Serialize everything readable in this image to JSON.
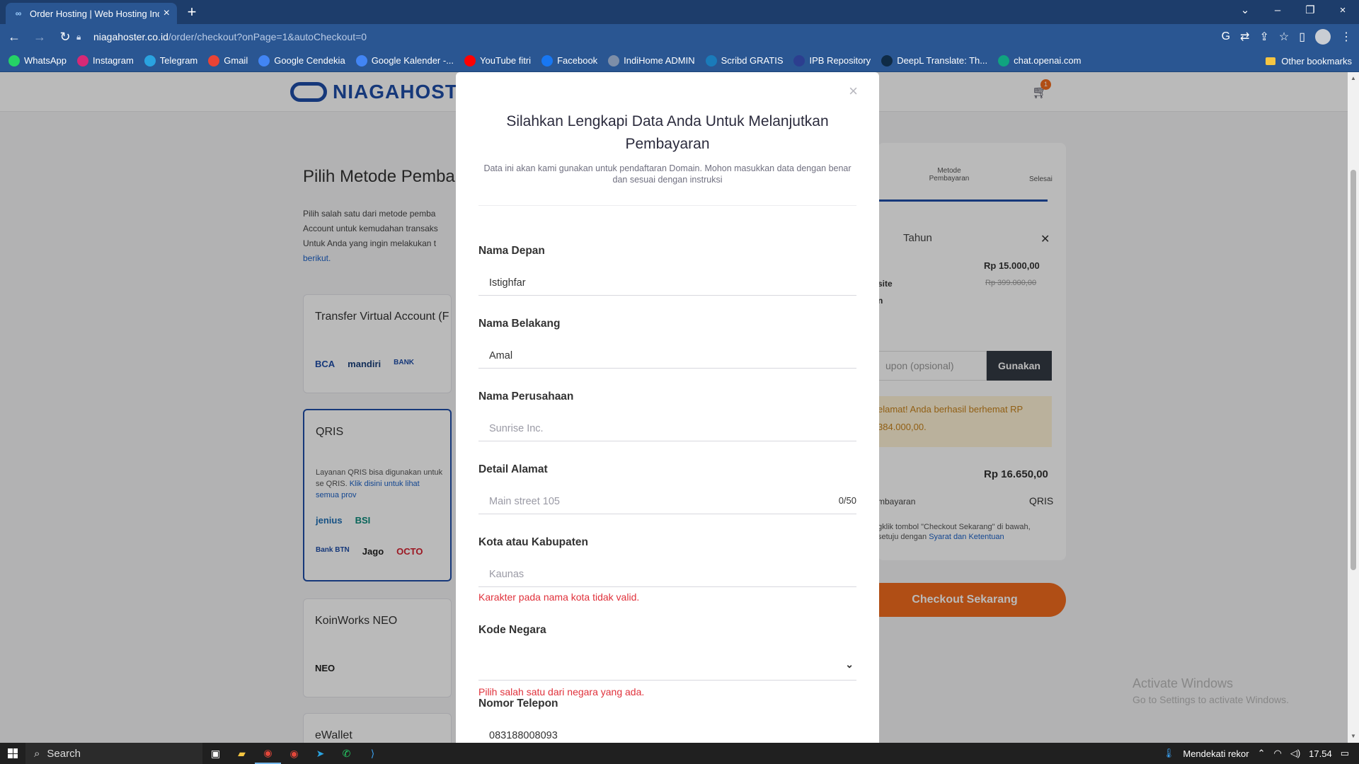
{
  "browser": {
    "tab_title": "Order Hosting | Web Hosting Ind",
    "url_host": "niagahoster.co.id",
    "url_path": "/order/checkout?onPage=1&autoCheckout=0",
    "bookmarks": [
      {
        "label": "WhatsApp",
        "color": "#25d366"
      },
      {
        "label": "Instagram",
        "color": "#d62976"
      },
      {
        "label": "Telegram",
        "color": "#2aa3e0"
      },
      {
        "label": "Gmail",
        "color": "#ea4335"
      },
      {
        "label": "Google Cendekia",
        "color": "#4285f4"
      },
      {
        "label": "Google Kalender -...",
        "color": "#4285f4"
      },
      {
        "label": "YouTube fitri",
        "color": "#ff0000"
      },
      {
        "label": "Facebook",
        "color": "#1877f2"
      },
      {
        "label": "IndiHome ADMIN",
        "color": "#7d8ea8"
      },
      {
        "label": "Scribd GRATIS",
        "color": "#1a7bba"
      },
      {
        "label": "IPB Repository",
        "color": "#2c3e8f"
      },
      {
        "label": "DeepL Translate: Th...",
        "color": "#0f2b46"
      },
      {
        "label": "chat.openai.com",
        "color": "#10a37f"
      }
    ],
    "other_bookmarks": "Other bookmarks"
  },
  "site": {
    "logo_text": "NIAGAHOSTER",
    "cart_count": "1",
    "section_title": "Pilih Metode Pemba",
    "section_desc_1": "Pilih salah satu dari metode pemba",
    "section_desc_2": "Account untuk kemudahan transaks",
    "section_desc_3": "Untuk Anda yang ingin melakukan t",
    "section_desc_link": "berikut.",
    "card_va_title": "Transfer Virtual Account (F",
    "card_va_logos": [
      "BCA",
      "mandiri",
      "BANK"
    ],
    "card_qris_title": "QRIS",
    "card_qris_desc": "Layanan QRIS bisa digunakan untuk se QRIS.",
    "card_qris_link": "Klik disini untuk lihat semua prov",
    "card_qris_logos_1": [
      "jenius",
      "BSI",
      ""
    ],
    "card_qris_logos_2": [
      "Bank BTN",
      "Jago",
      "OCTO"
    ],
    "card_koin_title": "KoinWorks NEO",
    "card_koin_logo": "NEO",
    "card_ewallet_title": "eWallet",
    "summary": {
      "step_label": "Metode Pembayaran",
      "step_done": "Selesai",
      "period": "Tahun",
      "price": "Rp 15.000,00",
      "price_old": "Rp 399.000,00",
      "frag_1": "site",
      "frag_2": "n",
      "coupon_placeholder": "upon (opsional)",
      "coupon_button": "Gunakan",
      "promo": "elamat! Anda berhasil berhemat RP 384.000,00.",
      "total": "Rp 16.650,00",
      "pay_label": "mbayaran",
      "pay_value": "QRIS",
      "terms": "gklik tombol \"Checkout Sekarang\" di bawah, setuju dengan",
      "terms_link": "Syarat dan Ketentuan"
    },
    "checkout_button": "Checkout Sekarang",
    "activate_title": "Activate Windows",
    "activate_sub": "Go to Settings to activate Windows."
  },
  "modal": {
    "close": "×",
    "title": "Silahkan Lengkapi Data Anda Untuk Melanjutkan Pembayaran",
    "subtitle": "Data ini akan kami gunakan untuk pendaftaran Domain. Mohon masukkan data dengan benar dan sesuai dengan instruksi",
    "fields": {
      "first_name": {
        "label": "Nama Depan",
        "value": "Istighfar"
      },
      "last_name": {
        "label": "Nama Belakang",
        "value": "Amal"
      },
      "company": {
        "label": "Nama Perusahaan",
        "placeholder": "Sunrise Inc."
      },
      "address": {
        "label": "Detail Alamat",
        "placeholder": "Main street 105",
        "counter": "0/50"
      },
      "city": {
        "label": "Kota atau Kabupaten",
        "placeholder": "Kaunas",
        "error": "Karakter pada nama kota tidak valid."
      },
      "country": {
        "label": "Kode Negara",
        "value": "",
        "error": "Pilih salah satu dari negara yang ada."
      },
      "phone": {
        "label": "Nomor Telepon",
        "value": "083188008093"
      }
    }
  },
  "taskbar": {
    "search": "Search",
    "weather": "Mendekati rekor",
    "time": "17.54"
  }
}
